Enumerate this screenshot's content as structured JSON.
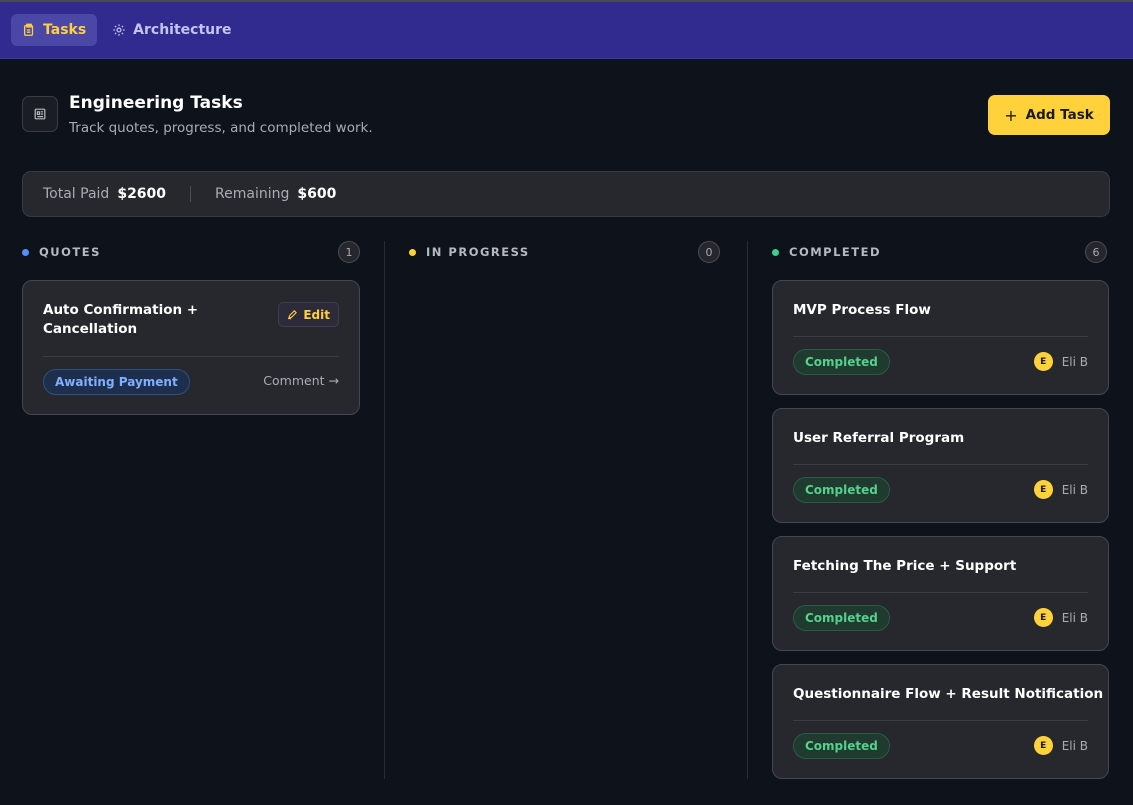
{
  "nav": {
    "tabs": [
      {
        "label": "Tasks",
        "icon": "clipboard-icon",
        "active": true
      },
      {
        "label": "Architecture",
        "icon": "gear-icon",
        "active": false
      }
    ]
  },
  "header": {
    "icon": "document-icon",
    "title": "Engineering Tasks",
    "subtitle": "Track quotes, progress, and completed work.",
    "add_button_label": "Add Task"
  },
  "summary": {
    "total_paid_label": "Total Paid",
    "total_paid_value": "$2600",
    "remaining_label": "Remaining",
    "remaining_value": "$600"
  },
  "columns": [
    {
      "title": "QUOTES",
      "count": "1",
      "dot_color": "#4f8fff",
      "cards": [
        {
          "title": "Auto Confirmation + Cancellation",
          "edit_label": "Edit",
          "status": "Awaiting Payment",
          "comment_label": "Comment"
        }
      ]
    },
    {
      "title": "IN PROGRESS",
      "count": "0",
      "dot_color": "#ffd23c",
      "cards": []
    },
    {
      "title": "COMPLETED",
      "count": "6",
      "dot_color": "#3ccf8e",
      "cards": [
        {
          "title": "MVP Process Flow",
          "status": "Completed",
          "assignee_initial": "E",
          "assignee": "Eli B"
        },
        {
          "title": "User Referral Program",
          "status": "Completed",
          "assignee_initial": "E",
          "assignee": "Eli B"
        },
        {
          "title": "Fetching The Price + Support",
          "status": "Completed",
          "assignee_initial": "E",
          "assignee": "Eli B"
        },
        {
          "title": "Questionnaire Flow + Result Notification",
          "status": "Completed",
          "assignee_initial": "E",
          "assignee": "Eli B"
        }
      ]
    }
  ],
  "colors": {
    "nav_bg": "#322b8f",
    "accent": "#ffd23c",
    "page_bg": "#0e121a",
    "completed_green": "#55d08e",
    "awaiting_blue": "#7fb0ff"
  }
}
